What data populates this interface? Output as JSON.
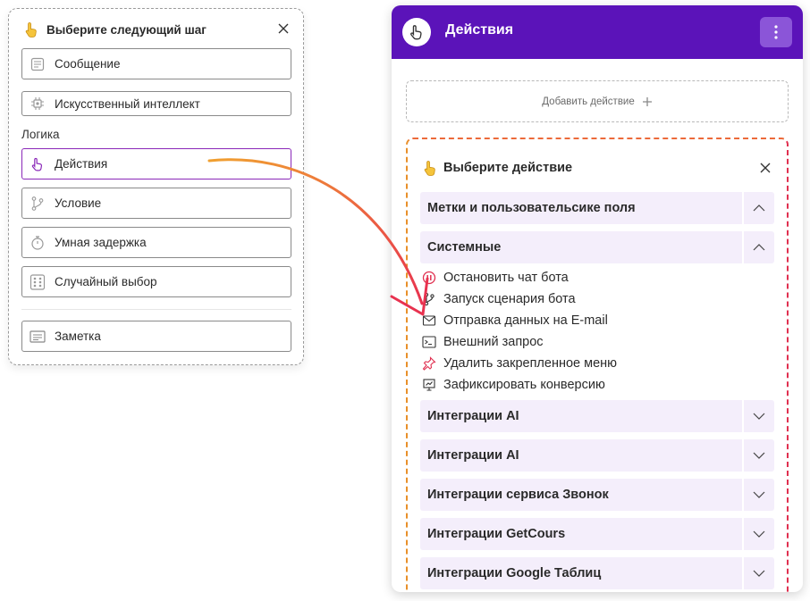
{
  "left_panel": {
    "title": "Выберите следующий шаг",
    "items": [
      {
        "label": "Сообщение",
        "icon": "message-icon"
      },
      {
        "label": "Искусственный интеллект",
        "icon": "ai-chip-icon"
      }
    ],
    "section_label": "Логика",
    "logic_items": [
      {
        "label": "Действия",
        "icon": "hand-pointer-icon",
        "active": true
      },
      {
        "label": "Условие",
        "icon": "branch-icon"
      },
      {
        "label": "Умная задержка",
        "icon": "timer-icon"
      },
      {
        "label": "Случайный выбор",
        "icon": "dice-icon"
      }
    ],
    "note_item": {
      "label": "Заметка",
      "icon": "note-icon"
    }
  },
  "right_panel": {
    "header_title": "Действия",
    "header_bg": "#5b13b9",
    "add_action_label": "Добавить действие",
    "choose_title": "Выберите действие",
    "accordion": [
      {
        "label": "Метки и пользовательсике поля",
        "expanded": true
      },
      {
        "label": "Системные",
        "expanded": true
      },
      {
        "label": "Интеграции AI",
        "expanded": false
      },
      {
        "label": "Интеграции AI",
        "expanded": false
      },
      {
        "label": "Интеграции сервиса Звонок",
        "expanded": false
      },
      {
        "label": "Интеграции GetCours",
        "expanded": false
      },
      {
        "label": "Интеграции Google Таблиц",
        "expanded": false
      }
    ],
    "system_items": [
      {
        "label": "Остановить чат бота",
        "icon": "stop-icon"
      },
      {
        "label": "Запуск сценария бота",
        "icon": "branch-icon"
      },
      {
        "label": "Отправка данных на E-mail",
        "icon": "mail-icon"
      },
      {
        "label": "Внешний запрос",
        "icon": "terminal-icon"
      },
      {
        "label": "Удалить закрепленное меню",
        "icon": "pin-icon"
      },
      {
        "label": "Зафиксировать конверсию",
        "icon": "chart-board-icon"
      }
    ]
  },
  "colors": {
    "accent_purple": "#5b13b9",
    "accordion_bg": "#f4eefb",
    "arrow_start": "#f0a030",
    "arrow_end": "#e8324f"
  }
}
